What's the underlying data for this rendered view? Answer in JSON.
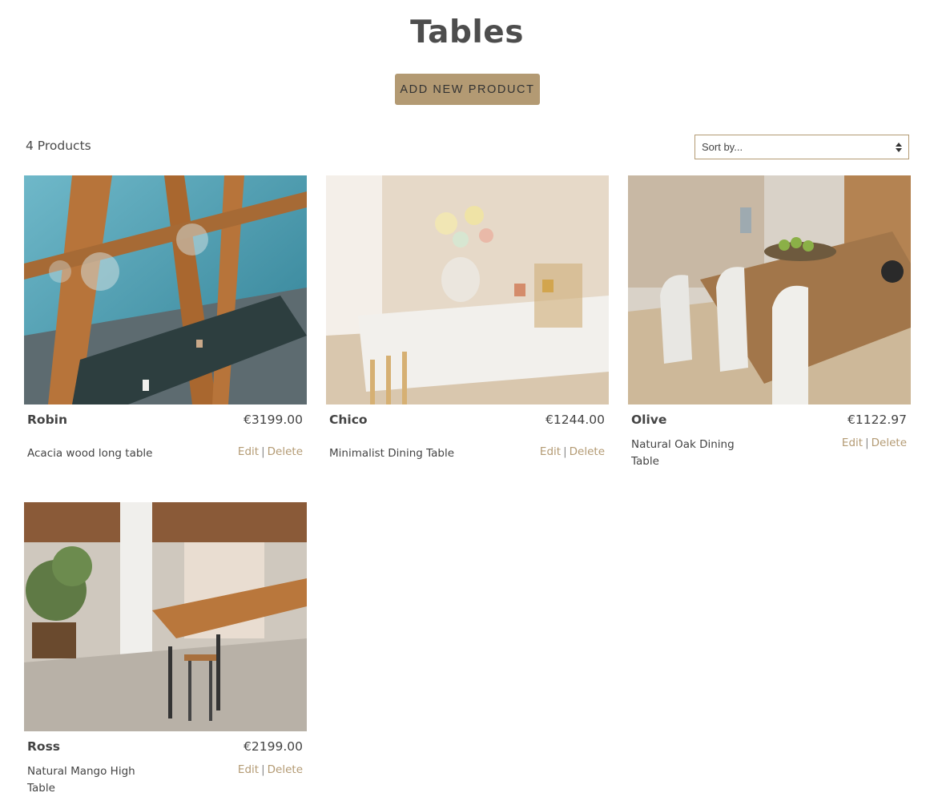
{
  "page": {
    "title": "Tables"
  },
  "header": {
    "add_button": "ADD NEW PRODUCT"
  },
  "toolbar": {
    "count_label": "4 Products",
    "sort_value": "Sort by..."
  },
  "products": [
    {
      "name": "Robin",
      "price": "€3199.00",
      "description": "Acacia wood long table",
      "edit": "Edit",
      "separator": "|",
      "delete": "Delete"
    },
    {
      "name": "Chico",
      "price": "€1244.00",
      "description": "Minimalist Dining Table",
      "edit": "Edit",
      "separator": "|",
      "delete": "Delete"
    },
    {
      "name": "Olive",
      "price": "€1122.97",
      "description": "Natural Oak Dining Table",
      "edit": "Edit",
      "separator": "|",
      "delete": "Delete"
    },
    {
      "name": "Ross",
      "price": "€2199.00",
      "description": "Natural Mango High Table",
      "edit": "Edit",
      "separator": "|",
      "delete": "Delete"
    }
  ],
  "colors": {
    "accent": "#b39a73",
    "text": "#4a4a4a"
  }
}
